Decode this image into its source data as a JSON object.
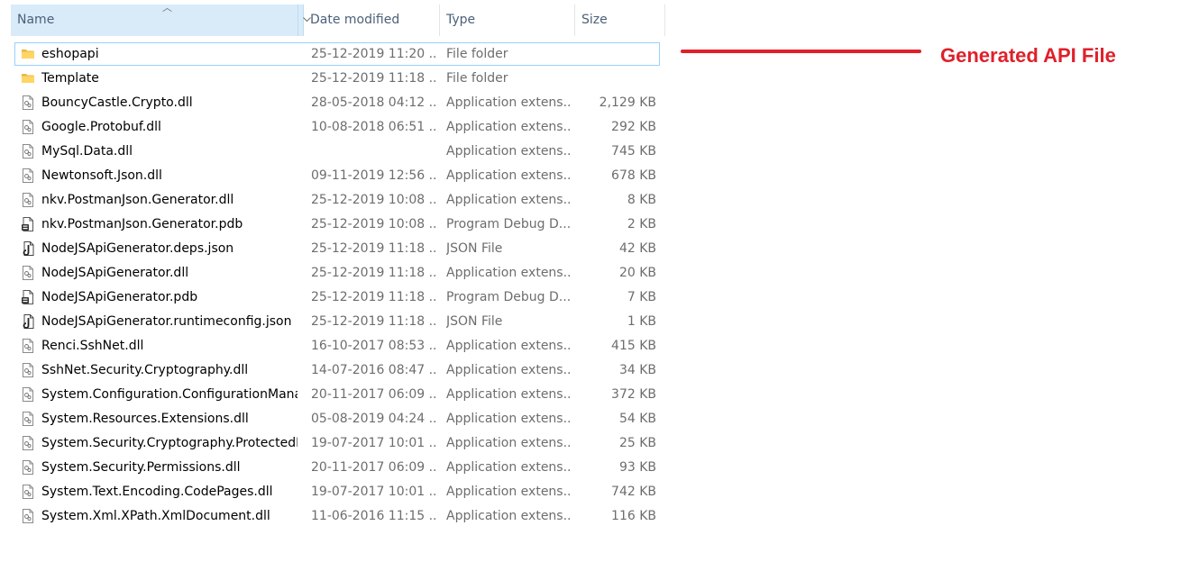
{
  "columns": {
    "name": "Name",
    "date": "Date modified",
    "type": "Type",
    "size": "Size"
  },
  "rows": [
    {
      "name": "eshopapi",
      "date": "25-12-2019 11:20 ...",
      "type": "File folder",
      "size": "",
      "icon": "folder-icon",
      "selected": true
    },
    {
      "name": "Template",
      "date": "25-12-2019 11:18 ...",
      "type": "File folder",
      "size": "",
      "icon": "folder-icon"
    },
    {
      "name": "BouncyCastle.Crypto.dll",
      "date": "28-05-2018 04:12 ...",
      "type": "Application extens...",
      "size": "2,129 KB",
      "icon": "dll-file-icon"
    },
    {
      "name": "Google.Protobuf.dll",
      "date": "10-08-2018 06:51 ...",
      "type": "Application extens...",
      "size": "292 KB",
      "icon": "dll-file-icon"
    },
    {
      "name": "MySql.Data.dll",
      "date": "",
      "type": "Application extens...",
      "size": "745 KB",
      "icon": "dll-file-icon"
    },
    {
      "name": "Newtonsoft.Json.dll",
      "date": "09-11-2019 12:56 ...",
      "type": "Application extens...",
      "size": "678 KB",
      "icon": "dll-file-icon"
    },
    {
      "name": "nkv.PostmanJson.Generator.dll",
      "date": "25-12-2019 10:08 ...",
      "type": "Application extens...",
      "size": "8 KB",
      "icon": "dll-file-icon"
    },
    {
      "name": "nkv.PostmanJson.Generator.pdb",
      "date": "25-12-2019 10:08 ...",
      "type": "Program Debug D...",
      "size": "2 KB",
      "icon": "pdb-file-icon"
    },
    {
      "name": "NodeJSApiGenerator.deps.json",
      "date": "25-12-2019 11:18 ...",
      "type": "JSON File",
      "size": "42 KB",
      "icon": "json-file-icon"
    },
    {
      "name": "NodeJSApiGenerator.dll",
      "date": "25-12-2019 11:18 ...",
      "type": "Application extens...",
      "size": "20 KB",
      "icon": "dll-file-icon"
    },
    {
      "name": "NodeJSApiGenerator.pdb",
      "date": "25-12-2019 11:18 ...",
      "type": "Program Debug D...",
      "size": "7 KB",
      "icon": "pdb-file-icon"
    },
    {
      "name": "NodeJSApiGenerator.runtimeconfig.json",
      "date": "25-12-2019 11:18 ...",
      "type": "JSON File",
      "size": "1 KB",
      "icon": "json-file-icon"
    },
    {
      "name": "Renci.SshNet.dll",
      "date": "16-10-2017 08:53 ...",
      "type": "Application extens...",
      "size": "415 KB",
      "icon": "dll-file-icon"
    },
    {
      "name": "SshNet.Security.Cryptography.dll",
      "date": "14-07-2016 08:47 ...",
      "type": "Application extens...",
      "size": "34 KB",
      "icon": "dll-file-icon"
    },
    {
      "name": "System.Configuration.ConfigurationMana...",
      "date": "20-11-2017 06:09 ...",
      "type": "Application extens...",
      "size": "372 KB",
      "icon": "dll-file-icon"
    },
    {
      "name": "System.Resources.Extensions.dll",
      "date": "05-08-2019 04:24 ...",
      "type": "Application extens...",
      "size": "54 KB",
      "icon": "dll-file-icon"
    },
    {
      "name": "System.Security.Cryptography.ProtectedD...",
      "date": "19-07-2017 10:01 ...",
      "type": "Application extens...",
      "size": "25 KB",
      "icon": "dll-file-icon"
    },
    {
      "name": "System.Security.Permissions.dll",
      "date": "20-11-2017 06:09 ...",
      "type": "Application extens...",
      "size": "93 KB",
      "icon": "dll-file-icon"
    },
    {
      "name": "System.Text.Encoding.CodePages.dll",
      "date": "19-07-2017 10:01 ...",
      "type": "Application extens...",
      "size": "742 KB",
      "icon": "dll-file-icon"
    },
    {
      "name": "System.Xml.XPath.XmlDocument.dll",
      "date": "11-06-2016 11:15 ...",
      "type": "Application extens...",
      "size": "116 KB",
      "icon": "dll-file-icon"
    }
  ],
  "annotation": {
    "text": "Generated API File",
    "color": "#e0202a"
  }
}
